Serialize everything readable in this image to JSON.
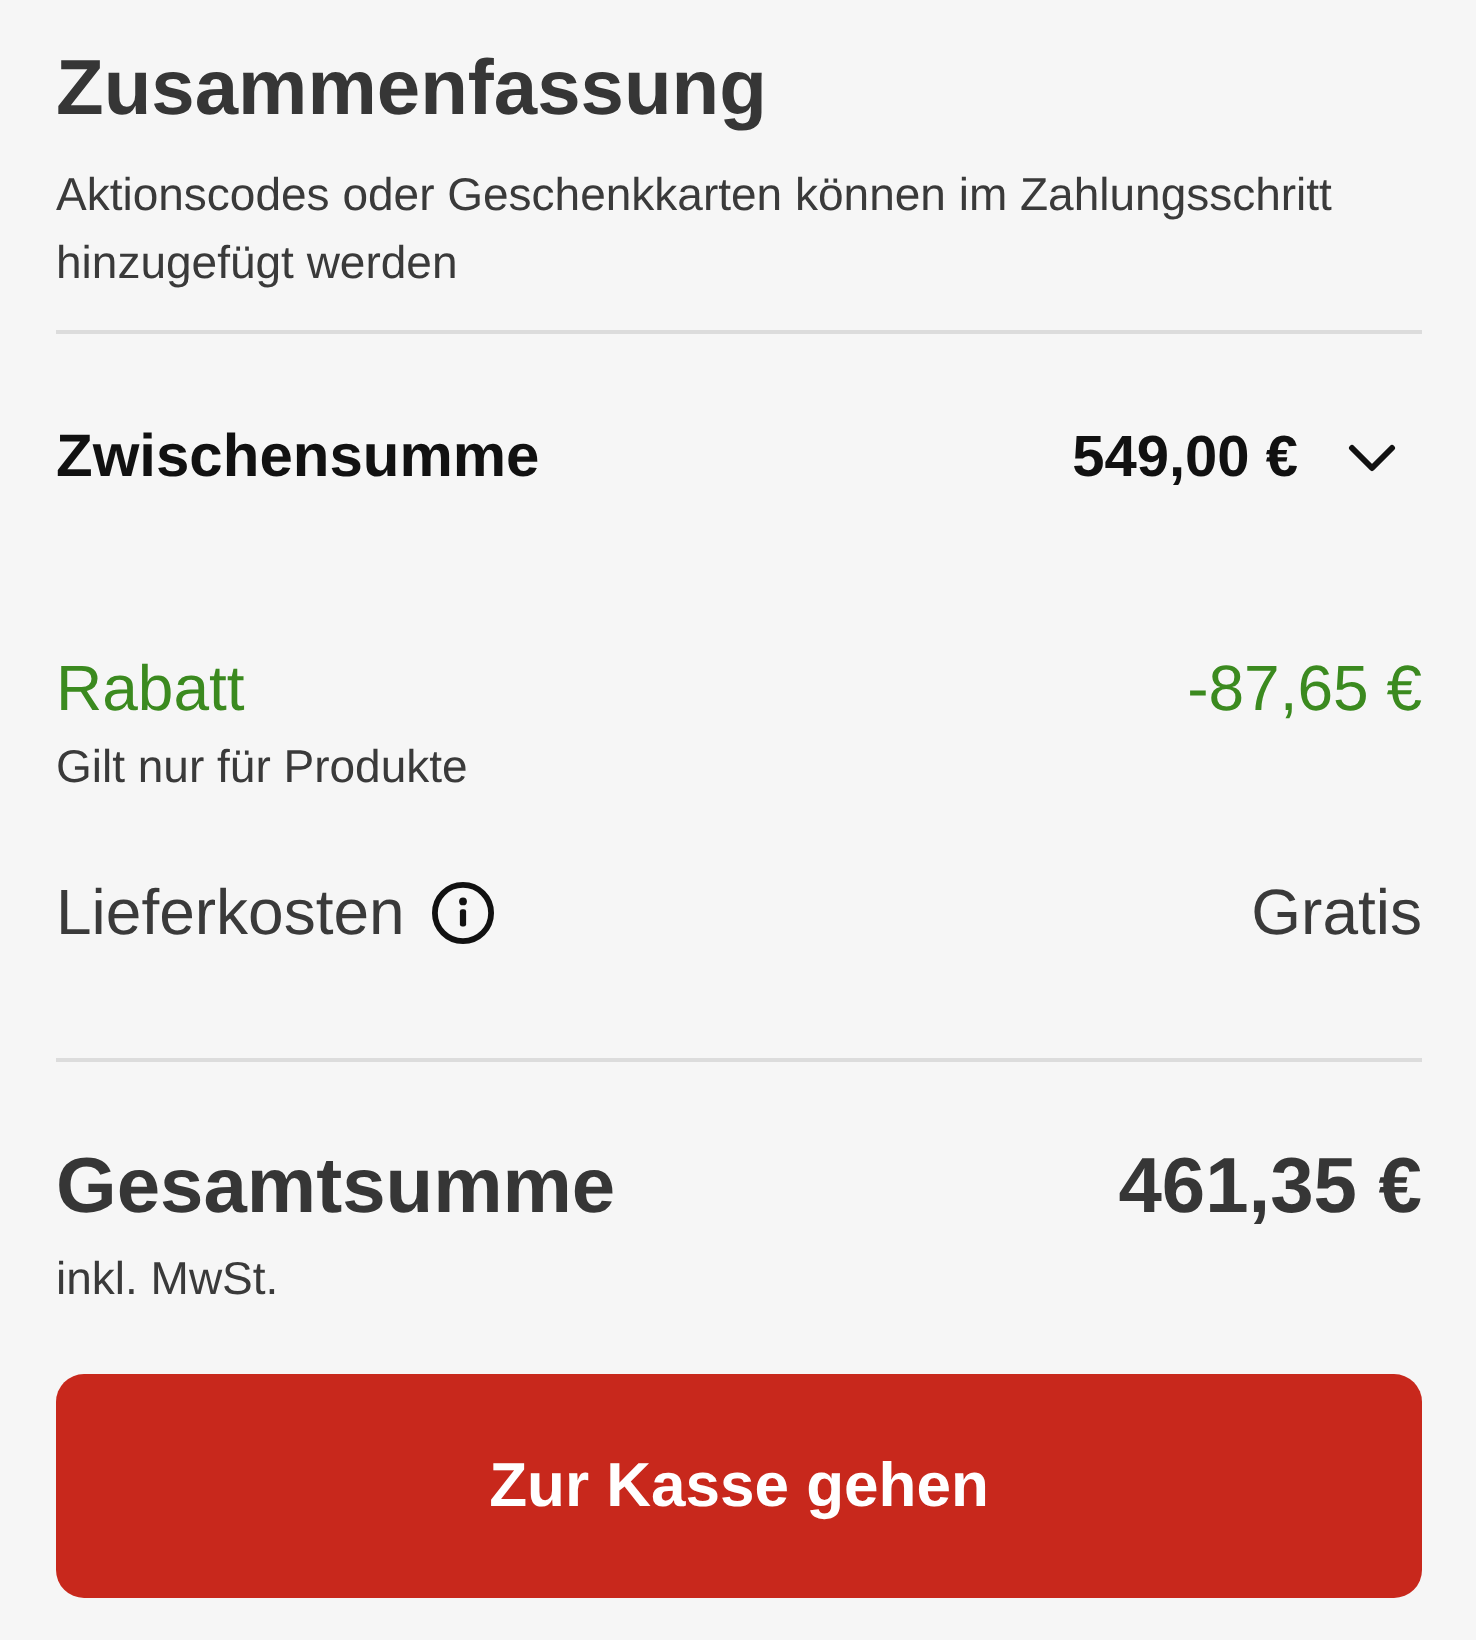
{
  "summary": {
    "title": "Zusammenfassung",
    "note": "Aktionscodes oder Geschenkkarten können im Zahlungsschritt hinzugefügt werden"
  },
  "subtotal": {
    "label": "Zwischensumme",
    "amount": "549,00 €",
    "expanded": false
  },
  "lines": [
    {
      "kind": "discount",
      "label": "Rabatt",
      "amount": "-87,65 €",
      "note": "Gilt nur für Produkte"
    },
    {
      "kind": "shipping",
      "label": "Lieferkosten",
      "amount": "Gratis",
      "info": true
    }
  ],
  "total": {
    "label": "Gesamtsumme",
    "amount": "461,35 €",
    "note": "inkl. MwSt."
  },
  "checkout_button": {
    "label": "Zur Kasse gehen"
  }
}
